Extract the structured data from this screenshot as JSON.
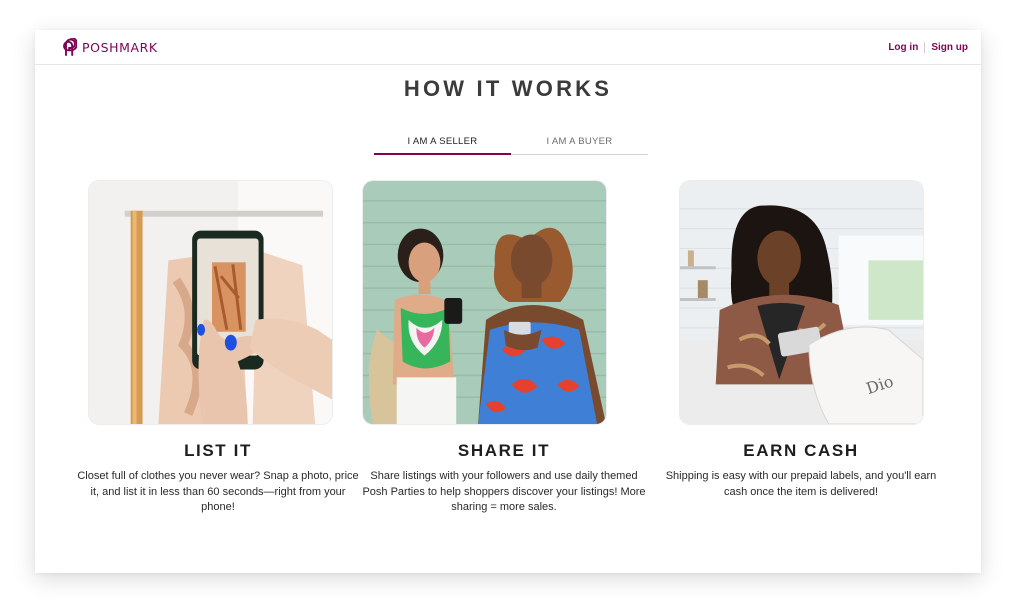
{
  "brand": {
    "name": "POSHMARK",
    "color": "#7f0353"
  },
  "header": {
    "login_label": "Log in",
    "signup_label": "Sign up"
  },
  "page": {
    "title": "HOW IT WORKS"
  },
  "tabs": [
    {
      "label": "I AM A SELLER",
      "active": true
    },
    {
      "label": "I AM A BUYER",
      "active": false
    }
  ],
  "cards": [
    {
      "title": "LIST IT",
      "text": "Closet full of clothes you never wear? Snap a photo, price it, and list it in less than 60 seconds—right from your phone!",
      "image": "photographing-clothes-with-phone"
    },
    {
      "title": "SHARE IT",
      "text": "Share listings with your followers and use daily themed Posh Parties to help shoppers discover your listings! More sharing = more sales.",
      "image": "two-friends-looking-at-phones"
    },
    {
      "title": "EARN CASH",
      "text": "Shipping is easy with our prepaid labels, and you'll earn cash once the item is delivered!",
      "image": "woman-unboxing-package-in-kitchen"
    }
  ]
}
